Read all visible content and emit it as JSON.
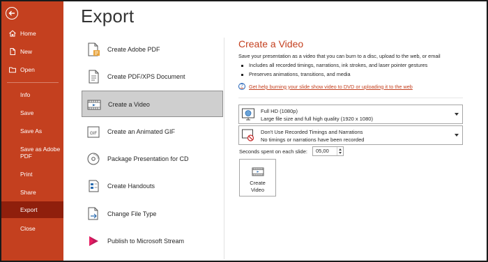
{
  "sidebar": {
    "items": [
      {
        "label": "Home",
        "icon": "home-icon"
      },
      {
        "label": "New",
        "icon": "new-doc-icon"
      },
      {
        "label": "Open",
        "icon": "folder-icon"
      },
      {
        "label": "Info"
      },
      {
        "label": "Save"
      },
      {
        "label": "Save As"
      },
      {
        "label": "Save as Adobe",
        "label2": "PDF"
      },
      {
        "label": "Print"
      },
      {
        "label": "Share"
      },
      {
        "label": "Export"
      },
      {
        "label": "Close"
      }
    ],
    "selected": "Export"
  },
  "page": {
    "title": "Export"
  },
  "export_options": [
    {
      "label": "Create Adobe PDF",
      "icon": "adobe-pdf-icon"
    },
    {
      "label": "Create PDF/XPS Document",
      "icon": "pdf-xps-icon"
    },
    {
      "label": "Create a Video",
      "icon": "video-icon"
    },
    {
      "label": "Create an Animated GIF",
      "icon": "gif-icon"
    },
    {
      "label": "Package Presentation for CD",
      "icon": "cd-icon"
    },
    {
      "label": "Create Handouts",
      "icon": "handouts-icon"
    },
    {
      "label": "Change File Type",
      "icon": "change-file-type-icon"
    },
    {
      "label": "Publish to Microsoft Stream",
      "icon": "stream-icon"
    }
  ],
  "selected_option": "Create a Video",
  "video_pane": {
    "title": "Create a Video",
    "description": "Save your presentation as a video that you can burn to a disc, upload to the web, or email",
    "bullets": [
      "Includes all recorded timings, narrations, ink strokes, and laser pointer gestures",
      "Preserves animations, transitions, and media"
    ],
    "help_link": "Get help burning your slide show video to DVD or uploading it to the web",
    "quality": {
      "line1": "Full HD (1080p)",
      "line2": "Large file size and full high quality (1920 x 1080)"
    },
    "timings": {
      "line1": "Don't Use Recorded Timings and Narrations",
      "line2": "No timings or narrations have been recorded"
    },
    "seconds_label": "Seconds spent on each slide:",
    "seconds_value": "05,00",
    "create_button": {
      "line1": "Create",
      "line2": "Video"
    }
  },
  "colors": {
    "accent": "#c4401f",
    "sidebar_selected": "#8f1f0c",
    "option_selected": "#cfcfcf"
  }
}
